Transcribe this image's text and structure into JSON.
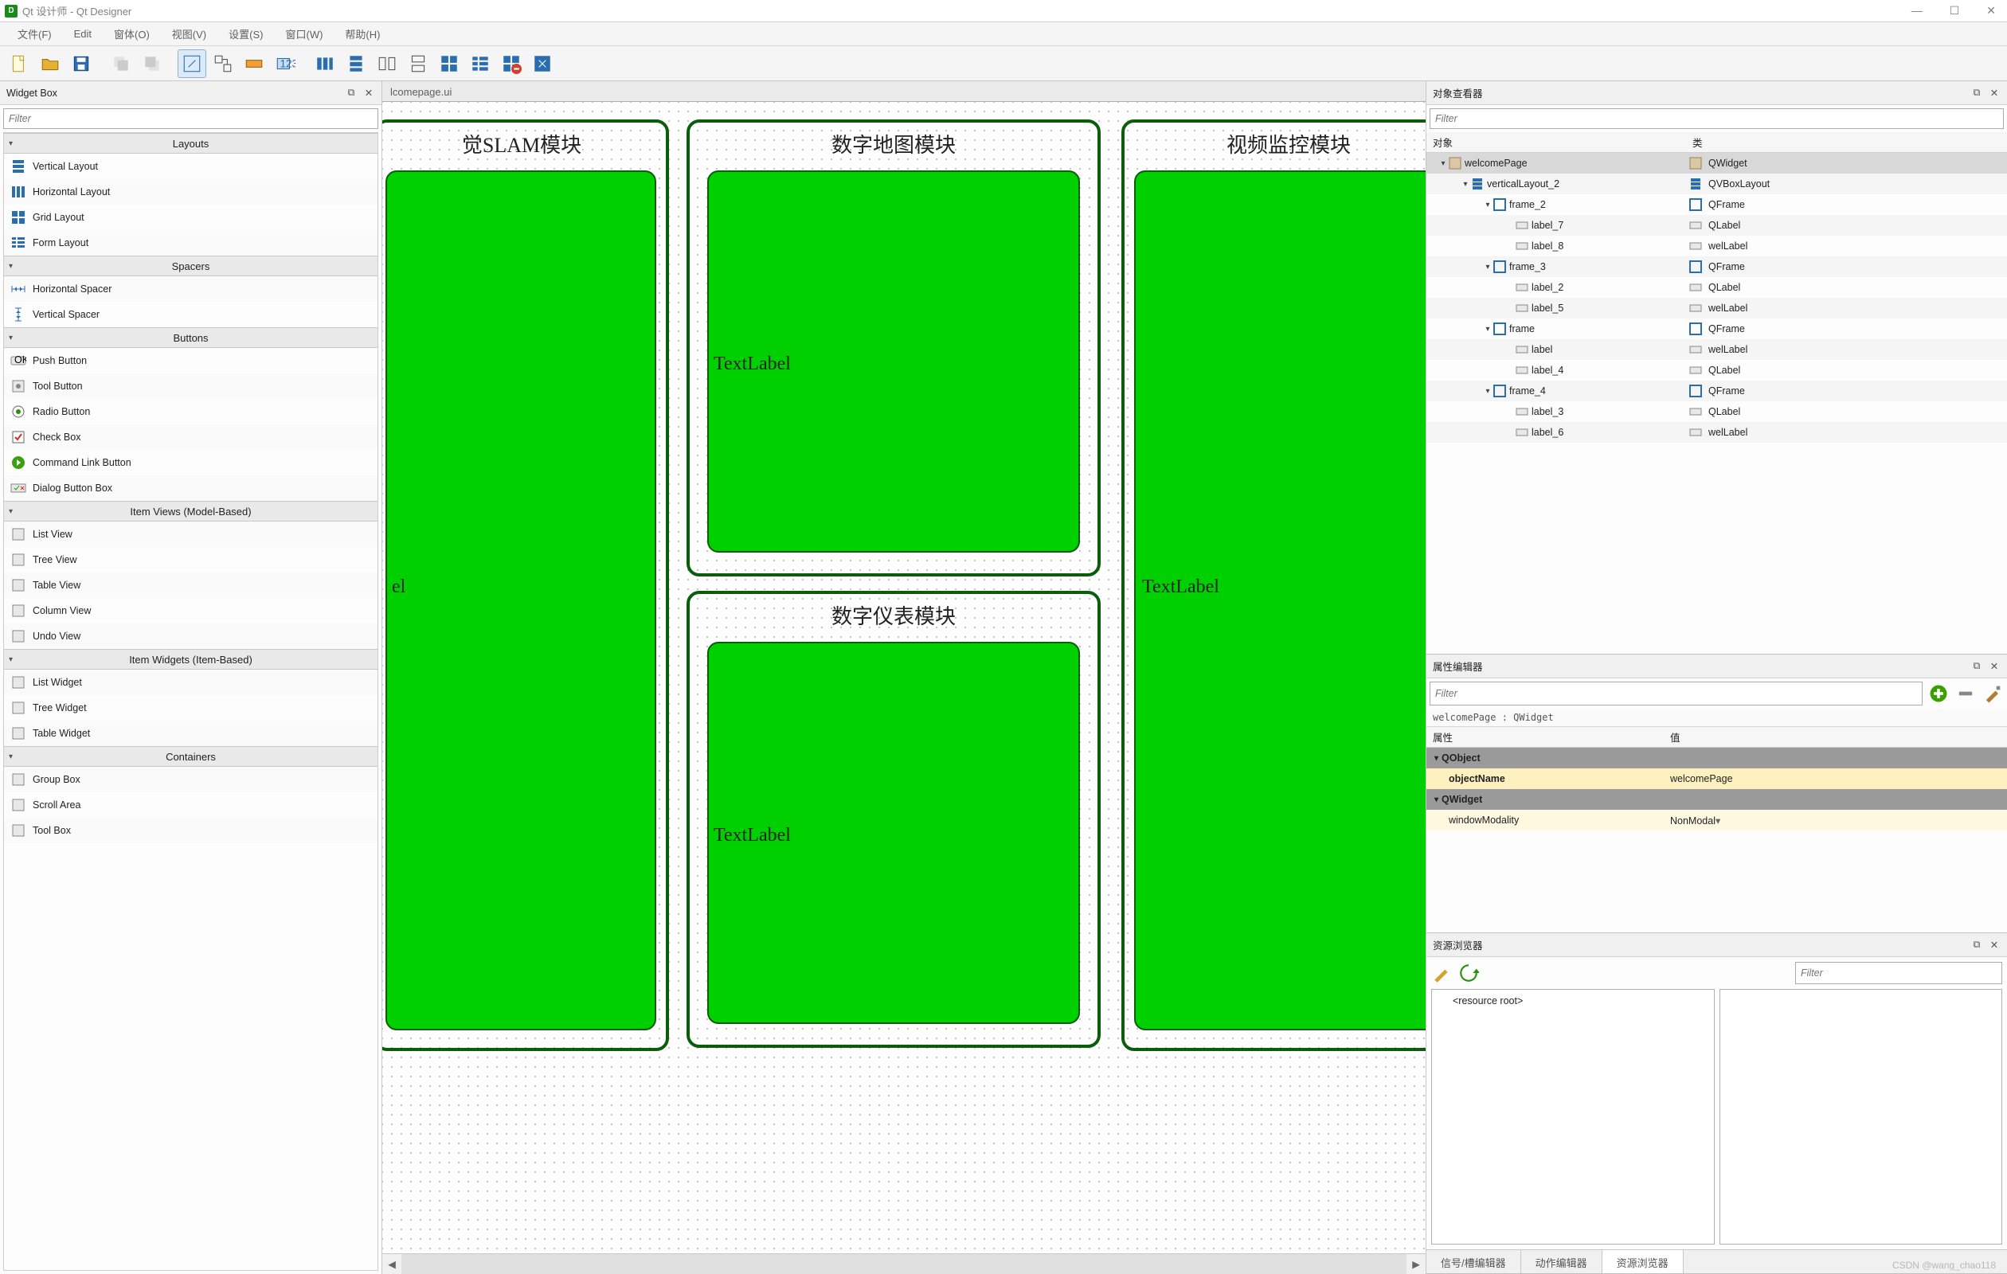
{
  "window": {
    "title": "Qt 设计师 - Qt Designer"
  },
  "menu": [
    "文件(F)",
    "Edit",
    "窗体(O)",
    "视图(V)",
    "设置(S)",
    "窗口(W)",
    "帮助(H)"
  ],
  "widgetBox": {
    "title": "Widget Box",
    "filterPlaceholder": "Filter",
    "groups": [
      {
        "name": "Layouts",
        "items": [
          "Vertical Layout",
          "Horizontal Layout",
          "Grid Layout",
          "Form Layout"
        ]
      },
      {
        "name": "Spacers",
        "items": [
          "Horizontal Spacer",
          "Vertical Spacer"
        ]
      },
      {
        "name": "Buttons",
        "items": [
          "Push Button",
          "Tool Button",
          "Radio Button",
          "Check Box",
          "Command Link Button",
          "Dialog Button Box"
        ]
      },
      {
        "name": "Item Views (Model-Based)",
        "items": [
          "List View",
          "Tree View",
          "Table View",
          "Column View",
          "Undo View"
        ]
      },
      {
        "name": "Item Widgets (Item-Based)",
        "items": [
          "List Widget",
          "Tree Widget",
          "Table Widget"
        ]
      },
      {
        "name": "Containers",
        "items": [
          "Group Box",
          "Scroll Area",
          "Tool Box"
        ]
      }
    ]
  },
  "design": {
    "file": "lcomepage.ui",
    "modules": [
      {
        "title": "觉SLAM模块",
        "label": "el"
      },
      {
        "title": "数字地图模块",
        "label": "TextLabel"
      },
      {
        "title": "数字仪表模块",
        "label": "TextLabel"
      },
      {
        "title": "视频监控模块",
        "label": "TextLabel"
      }
    ]
  },
  "objectInspector": {
    "title": "对象查看器",
    "filterPlaceholder": "Filter",
    "headers": [
      "对象",
      "类"
    ],
    "rows": [
      {
        "d": 0,
        "exp": "v",
        "n": "welcomePage",
        "c": "QWidget",
        "sel": true,
        "ic": "widget"
      },
      {
        "d": 1,
        "exp": "v",
        "n": "verticalLayout_2",
        "c": "QVBoxLayout",
        "ic": "vlay"
      },
      {
        "d": 2,
        "exp": "v",
        "n": "frame_2",
        "c": "QFrame",
        "ic": "frame"
      },
      {
        "d": 3,
        "exp": "",
        "n": "label_7",
        "c": "QLabel",
        "ic": "label"
      },
      {
        "d": 3,
        "exp": "",
        "n": "label_8",
        "c": "welLabel",
        "ic": "label"
      },
      {
        "d": 2,
        "exp": "v",
        "n": "frame_3",
        "c": "QFrame",
        "ic": "frame"
      },
      {
        "d": 3,
        "exp": "",
        "n": "label_2",
        "c": "QLabel",
        "ic": "label"
      },
      {
        "d": 3,
        "exp": "",
        "n": "label_5",
        "c": "welLabel",
        "ic": "label"
      },
      {
        "d": 2,
        "exp": "v",
        "n": "frame",
        "c": "QFrame",
        "ic": "frame"
      },
      {
        "d": 3,
        "exp": "",
        "n": "label",
        "c": "welLabel",
        "ic": "label"
      },
      {
        "d": 3,
        "exp": "",
        "n": "label_4",
        "c": "QLabel",
        "ic": "label"
      },
      {
        "d": 2,
        "exp": "v",
        "n": "frame_4",
        "c": "QFrame",
        "ic": "frame"
      },
      {
        "d": 3,
        "exp": "",
        "n": "label_3",
        "c": "QLabel",
        "ic": "label"
      },
      {
        "d": 3,
        "exp": "",
        "n": "label_6",
        "c": "welLabel",
        "ic": "label"
      }
    ]
  },
  "propertyEditor": {
    "title": "属性编辑器",
    "filterPlaceholder": "Filter",
    "info": "welcomePage : QWidget",
    "headers": [
      "属性",
      "值"
    ],
    "rows": [
      {
        "type": "group",
        "name": "QObject"
      },
      {
        "type": "prop",
        "name": "objectName",
        "value": "welcomePage",
        "bold": true
      },
      {
        "type": "group",
        "name": "QWidget"
      },
      {
        "type": "prop",
        "name": "windowModality",
        "value": "NonModal",
        "dd": true
      }
    ]
  },
  "resourceBrowser": {
    "title": "资源浏览器",
    "filterPlaceholder": "Filter",
    "root": "<resource root>"
  },
  "bottomTabs": [
    "信号/槽编辑器",
    "动作编辑器",
    "资源浏览器"
  ],
  "watermark": "CSDN @wang_chao118"
}
